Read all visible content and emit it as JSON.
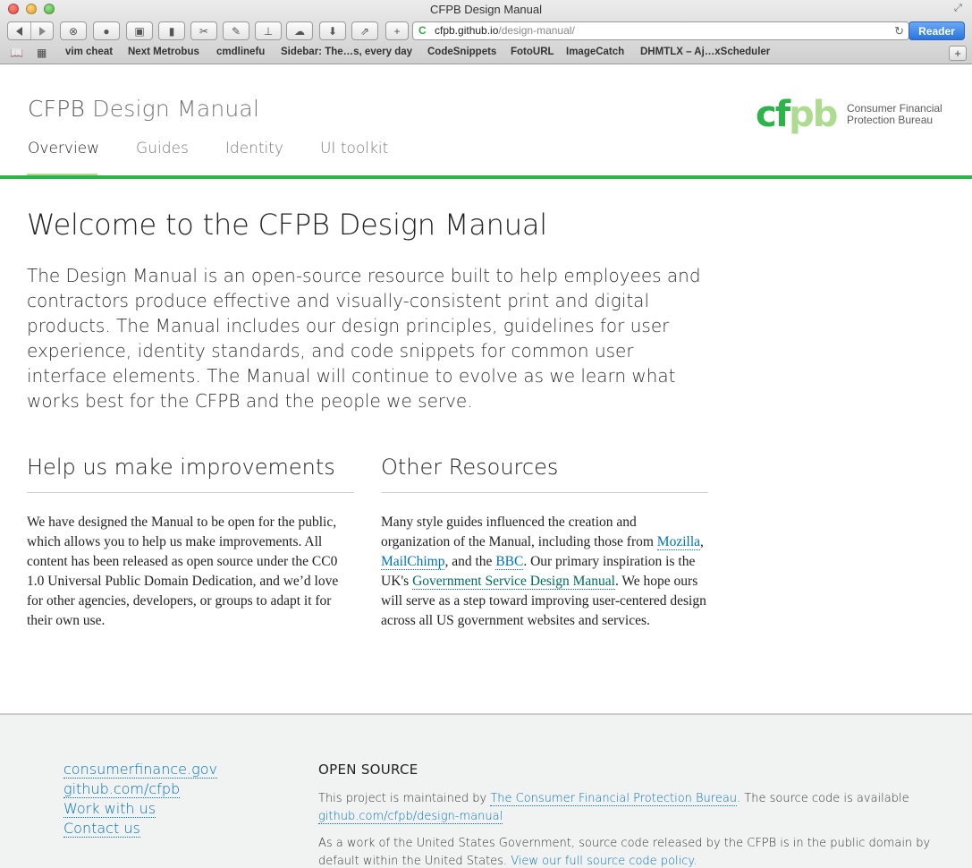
{
  "browser": {
    "window_title": "CFPB Design Manual",
    "url_host": "cfpb.github.io",
    "url_path": "/design-manual/",
    "reader_label": "Reader",
    "bookmarks": [
      "vim cheat",
      "Next Metrobus",
      "cmdlinefu",
      "Sidebar: The…s, every day",
      "CodeSnippets",
      "FotoURL",
      "ImageCatch",
      "DHMTLX – Aj…xScheduler"
    ]
  },
  "header": {
    "brand": "CFPB",
    "title": "Design Manual",
    "logo_mark_a": "cf",
    "logo_mark_b": "pb",
    "logo_line1": "Consumer Financial",
    "logo_line2": "Protection Bureau",
    "nav": [
      "Overview",
      "Guides",
      "Identity",
      "UI toolkit"
    ],
    "active_nav": "Overview",
    "accent_color": "#2cb34a",
    "accent_light": "#addc91"
  },
  "main": {
    "heading": "Welcome to the CFPB Design Manual",
    "lead": "The Design Manual is an open-source resource built to help employees and contractors produce effective and visually-consistent print and digital products. The Manual includes our design principles, guidelines for user experience, identity standards, and code snippets for common user interface elements. The Manual will continue to evolve as we learn what works best for the CFPB and the people we serve.",
    "improvements": {
      "heading": "Help us make improvements",
      "body": "We have designed the Manual to be open for the public, which allows you to help us make improvements. All content has been released as open source under the CC0 1.0 Universal Public Domain Dedication, and we’d love for other agencies, developers, or groups to adapt it for their own use."
    },
    "resources": {
      "heading": "Other Resources",
      "text1": "Many style guides influenced the creation and organization of the Manual, including those from ",
      "link_mozilla": "Mozilla",
      "sep1": ", ",
      "link_mailchimp": "MailChimp",
      "text2": ", and the ",
      "link_bbc": "BBC",
      "text3": ". Our primary inspiration is the UK's ",
      "link_gov": "Government Service Design Manual",
      "text4": ". We hope ours will serve as a step toward improving user-centered design across all US government websites and services."
    }
  },
  "footer": {
    "links": [
      "consumerfinance.gov",
      "github.com/cfpb",
      "Work with us",
      "Contact us"
    ],
    "os_heading": "OPEN SOURCE",
    "p1_text": "This project is maintained by ",
    "p1_link": "The Consumer Financial Protection Bureau",
    "p1_text2": ". The source code is available ",
    "p1_link2": "github.com/cfpb/design-manual",
    "p2_text": "As a work of the United States Government, source code released by the CFPB is in the public domain by default within the United States. ",
    "p2_link": "View our full source code policy."
  }
}
